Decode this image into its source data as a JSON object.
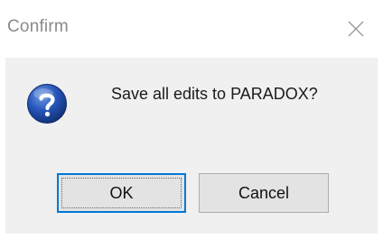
{
  "window": {
    "title": "Confirm",
    "close_icon": "close-icon"
  },
  "message": {
    "icon": "question-icon",
    "text": "Save all edits to PARADOX?"
  },
  "buttons": {
    "ok_label": "OK",
    "cancel_label": "Cancel"
  },
  "colors": {
    "focus_border": "#0078d7",
    "client_background": "#f0f0f0",
    "icon_blue": "#1f4fa8"
  }
}
